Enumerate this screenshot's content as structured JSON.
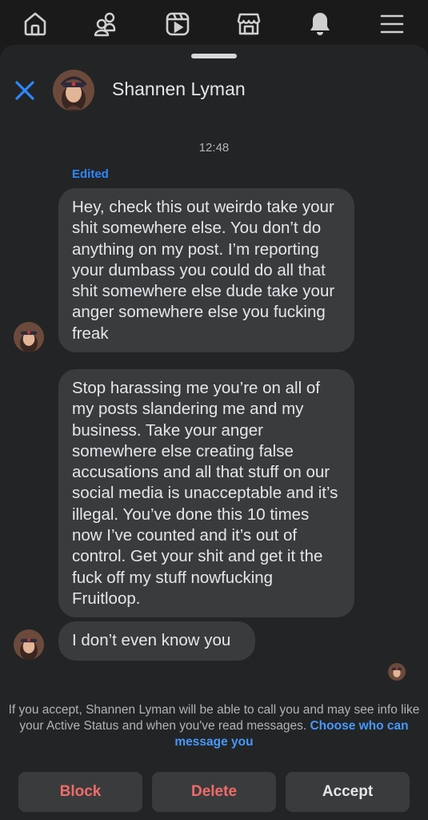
{
  "topnav": {
    "icons": [
      "home-icon",
      "friends-icon",
      "video-icon",
      "marketplace-icon",
      "notifications-icon",
      "menu-icon"
    ]
  },
  "header": {
    "contact_name": "Shannen Lyman"
  },
  "conversation": {
    "timestamp": "12:48",
    "edited_label": "Edited",
    "messages": [
      {
        "text": "Hey, check this out weirdo take your shit somewhere else. You don’t do anything on my post. I’m reporting your dumbass you could do all that shit somewhere else dude take your anger somewhere else you fucking freak"
      },
      {
        "text": "Stop harassing me you’re on all of my posts slandering me and my business. Take your anger somewhere else creating false accusations and all that stuff on our social media is unacceptable and it’s illegal. You’ve done this 10 times now I’ve counted and it’s out of control. Get your shit and get it the fuck off my stuff nowfucking Fruitloop."
      },
      {
        "text": "I don’t even know you"
      }
    ]
  },
  "request_notice": {
    "text": "If you accept, Shannen Lyman will be able to call you and may see info like your Active Status and when you've read messages.",
    "link": "Choose who can message you"
  },
  "actions": {
    "block": "Block",
    "delete": "Delete",
    "accept": "Accept"
  },
  "colors": {
    "background": "#1a1a1a",
    "sheet": "#232425",
    "bubble": "#3a3b3c",
    "accent_blue": "#2d88ff",
    "destructive_red": "#f06b6b"
  }
}
